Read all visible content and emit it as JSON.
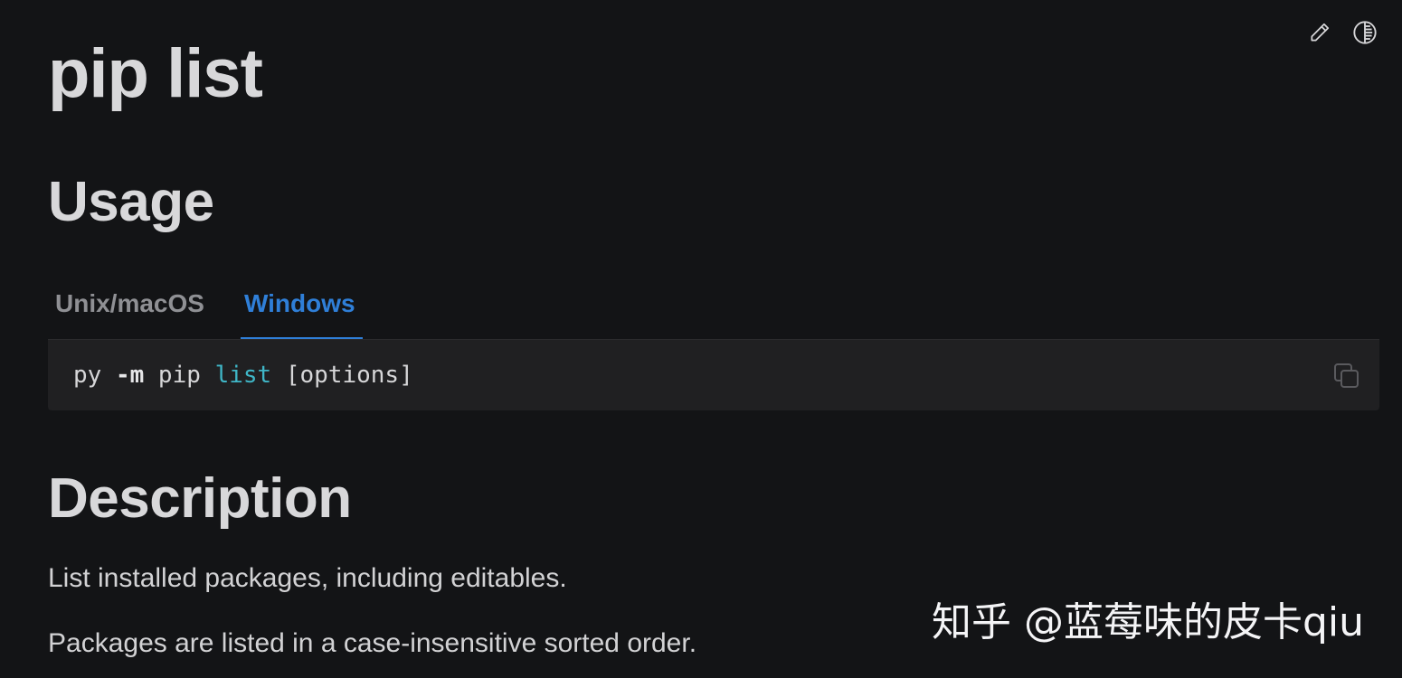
{
  "page": {
    "title": "pip list"
  },
  "toolbar": {
    "edit_icon": "pencil-icon",
    "theme_icon": "theme-toggle-icon"
  },
  "usage": {
    "heading": "Usage",
    "tabs": [
      {
        "label": "Unix/macOS",
        "active": false
      },
      {
        "label": "Windows",
        "active": true
      }
    ],
    "code": {
      "cmd": "py ",
      "flag": "-m",
      "pip": " pip ",
      "keyword": "list",
      "args": " [options]"
    },
    "copy_icon": "copy-icon"
  },
  "description": {
    "heading": "Description",
    "paragraphs": [
      "List installed packages, including editables.",
      "Packages are listed in a case-insensitive sorted order."
    ]
  },
  "watermark": {
    "text": "知乎 @蓝莓味的皮卡qiu"
  },
  "colors": {
    "background": "#131416",
    "accent": "#2f7fd8",
    "code_keyword": "#3fb6c7",
    "code_background": "#202022"
  }
}
